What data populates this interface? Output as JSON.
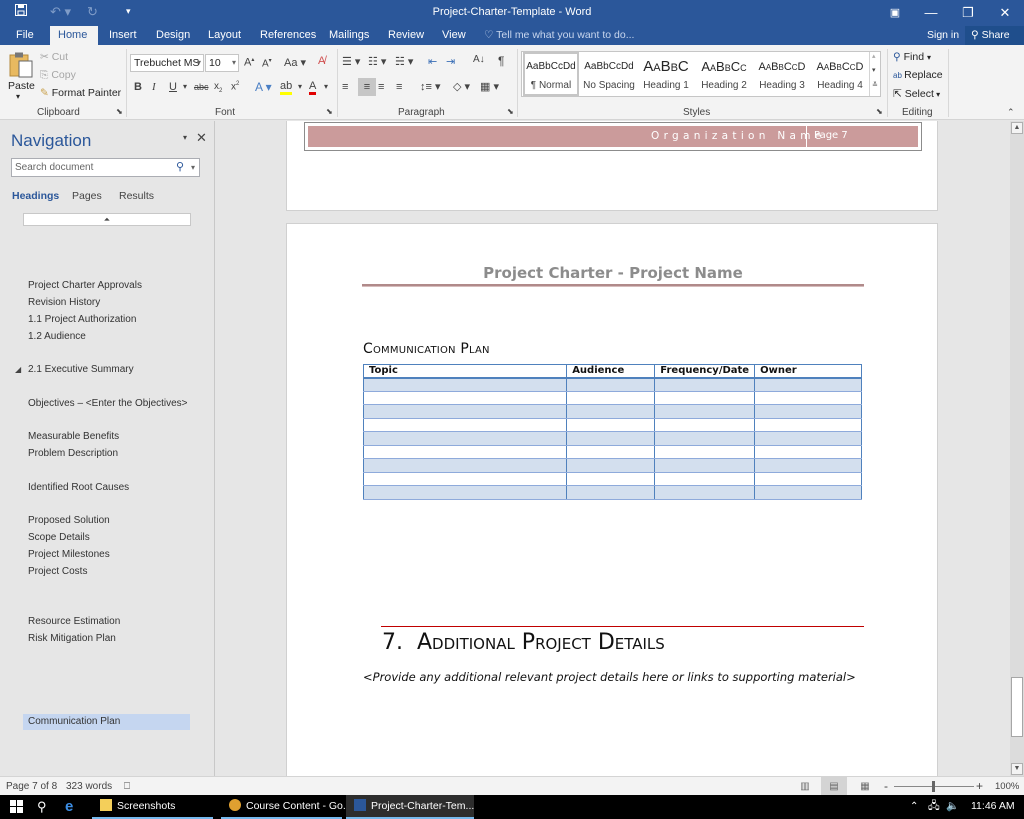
{
  "window": {
    "title": "Project-Charter-Template - Word",
    "qat": {
      "save_icon": "save-icon",
      "undo_icon": "undo-icon",
      "redo_icon": "redo-icon",
      "customize_icon": "customize-qat-icon"
    },
    "controls": {
      "ribbon_display": "▣",
      "minimize": "—",
      "restore": "❐",
      "close": "✕"
    }
  },
  "tabs": [
    {
      "label": "File"
    },
    {
      "label": "Home"
    },
    {
      "label": "Insert"
    },
    {
      "label": "Design"
    },
    {
      "label": "Layout"
    },
    {
      "label": "References"
    },
    {
      "label": "Mailings"
    },
    {
      "label": "Review"
    },
    {
      "label": "View"
    }
  ],
  "tell_me": "Tell me what you want to do...",
  "sign_in": "Sign in",
  "share": "Share",
  "ribbon": {
    "clipboard": {
      "paste": "Paste",
      "cut": "Cut",
      "copy": "Copy",
      "format_painter": "Format Painter",
      "label": "Clipboard"
    },
    "font": {
      "name": "Trebuchet MS",
      "size": "10",
      "label": "Font",
      "change_case": "Aa"
    },
    "paragraph": {
      "label": "Paragraph"
    },
    "styles": {
      "label": "Styles",
      "items": [
        {
          "preview": "AaBbCcDd",
          "label": "¶ Normal"
        },
        {
          "preview": "AaBbCcDd",
          "label": "No Spacing"
        },
        {
          "preview": "AaBbC",
          "label": "Heading 1"
        },
        {
          "preview": "AaBbCc",
          "label": "Heading 2"
        },
        {
          "preview": "AaBbCcD",
          "label": "Heading 3"
        },
        {
          "preview": "AaBbCcD",
          "label": "Heading 4"
        }
      ]
    },
    "editing": {
      "find": "Find",
      "replace": "Replace",
      "select": "Select",
      "label": "Editing"
    }
  },
  "navigation": {
    "title": "Navigation",
    "search_placeholder": "Search document",
    "tabs": [
      "Headings",
      "Pages",
      "Results"
    ],
    "active_tab": "Headings",
    "items": [
      {
        "label": "Project Charter Approvals"
      },
      {
        "label": "Revision History"
      },
      {
        "label": "1.1 Project Authorization"
      },
      {
        "label": "1.2  Audience"
      },
      {
        "label": "2.1 Executive Summary",
        "expanded": true
      },
      {
        "label": "Objectives – <Enter the Objectives>"
      },
      {
        "label": "Measurable Benefits"
      },
      {
        "label": "Problem Description"
      },
      {
        "label": "Identified Root Causes"
      },
      {
        "label": "Proposed Solution"
      },
      {
        "label": "Scope Details"
      },
      {
        "label": "Project Milestones"
      },
      {
        "label": "Project Costs"
      },
      {
        "label": "Resource Estimation"
      },
      {
        "label": "Risk Mitigation Plan"
      },
      {
        "label": "Communication Plan",
        "selected": true
      }
    ]
  },
  "document": {
    "footer": {
      "org_name": "Organization Name",
      "page": "Page 7"
    },
    "header_title": "Project Charter - Project Name",
    "comm_plan": {
      "heading": "Communication Plan",
      "columns": [
        "Topic",
        "Audience",
        "Frequency/Date",
        "Owner"
      ],
      "rows": [
        [
          "",
          "",
          "",
          ""
        ],
        [
          "",
          "",
          "",
          ""
        ],
        [
          "",
          "",
          "",
          ""
        ],
        [
          "",
          "",
          "",
          ""
        ],
        [
          "",
          "",
          "",
          ""
        ],
        [
          "",
          "",
          "",
          ""
        ],
        [
          "",
          "",
          "",
          ""
        ],
        [
          "",
          "",
          "",
          ""
        ],
        [
          "",
          "",
          "",
          ""
        ]
      ]
    },
    "section7": {
      "number": "7.",
      "title": "Additional Project Details",
      "body": "<Provide any additional relevant project details here or links to supporting material>"
    },
    "colors": {
      "footer_band": "#cb9b9b",
      "table_border": "#4f81bd",
      "table_band": "#d3dfee",
      "heading_rule": "#c00000",
      "accent": "#2b579a"
    }
  },
  "status": {
    "page": "Page 7 of 8",
    "words": "323 words",
    "zoom": "100%",
    "zoom_minus": "-",
    "zoom_plus": "+"
  },
  "taskbar": {
    "apps": [
      {
        "label": "Screenshots"
      },
      {
        "label": "Course Content - Go..."
      },
      {
        "label": "Project-Charter-Tem..."
      }
    ],
    "time": "11:46 AM"
  }
}
